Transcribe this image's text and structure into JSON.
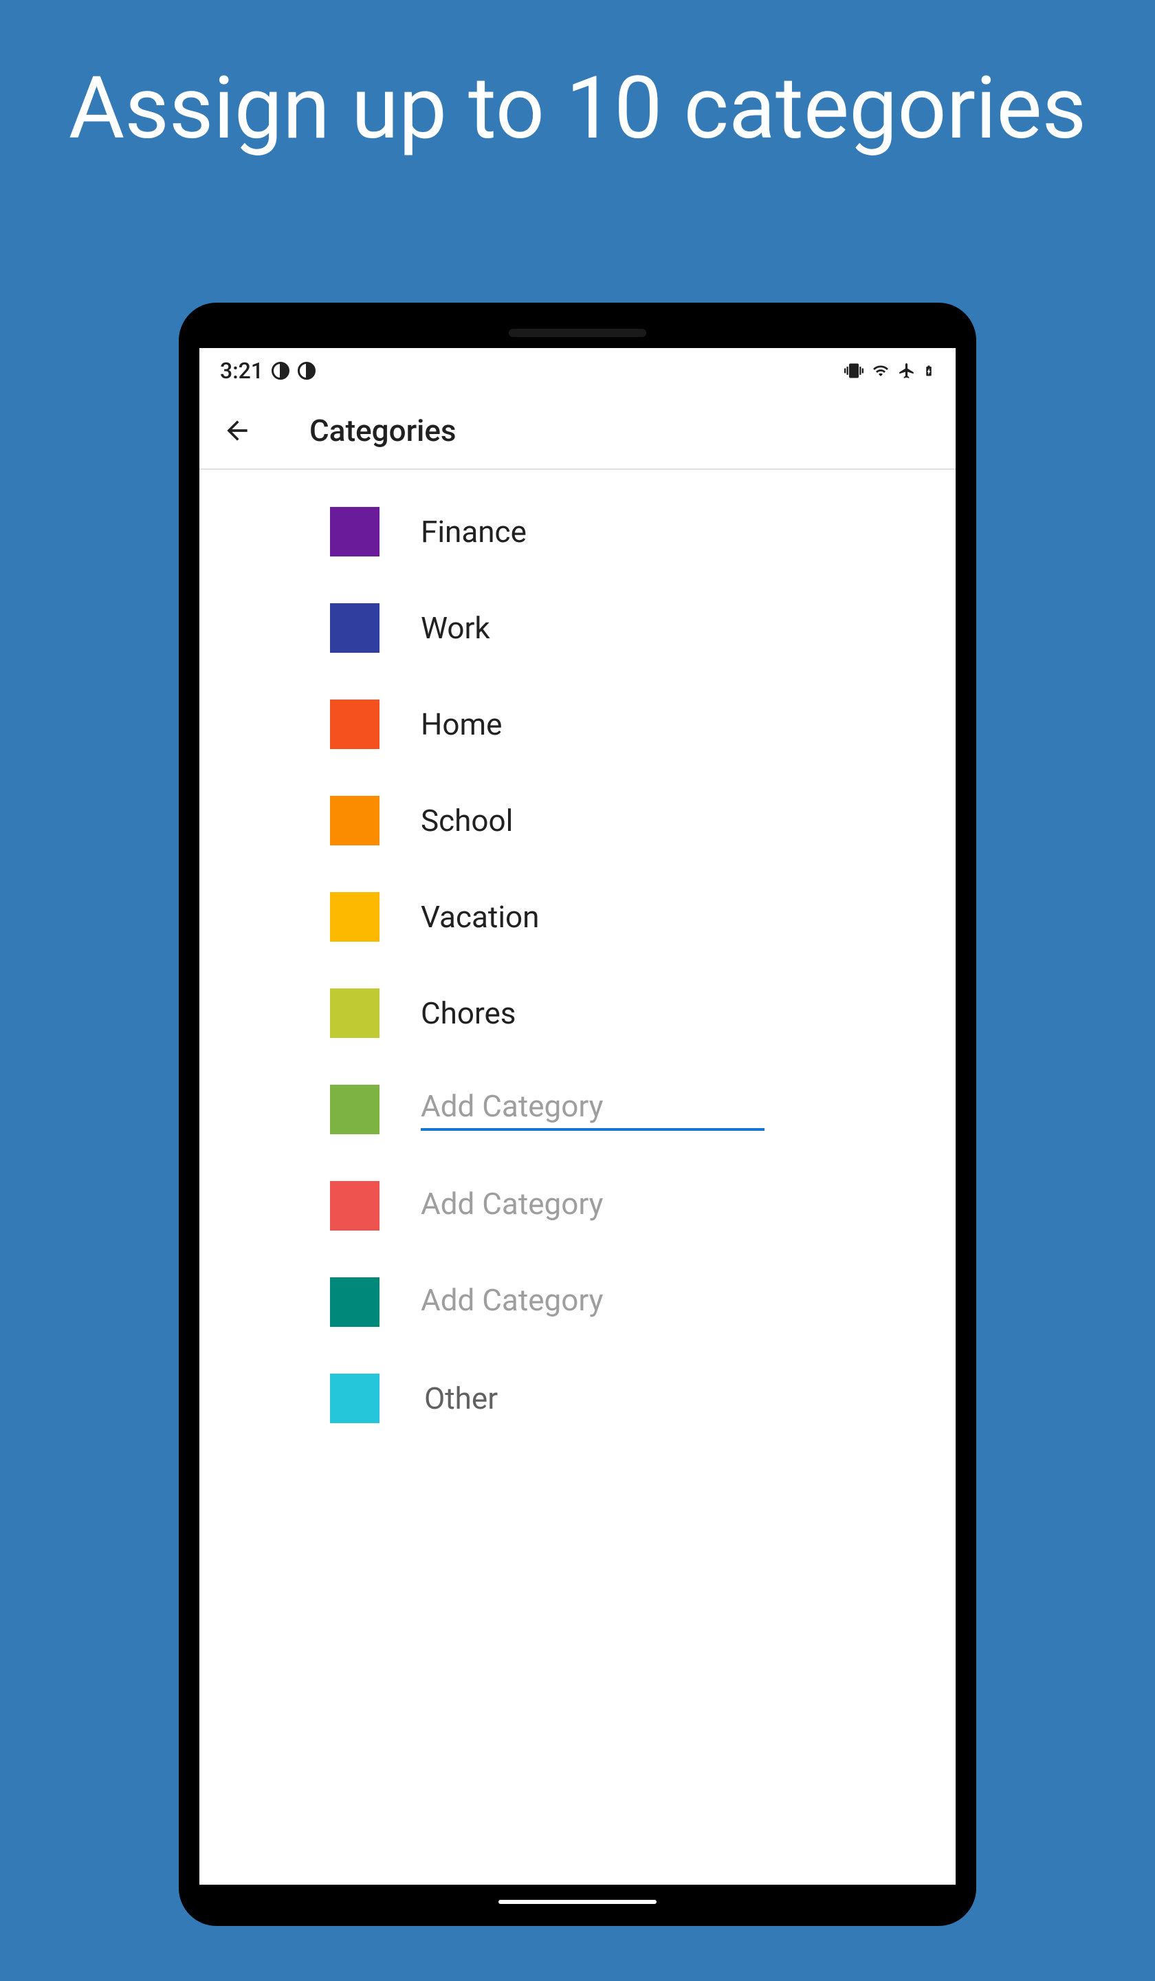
{
  "promo_title": "Assign up to 10 categories",
  "status_bar": {
    "time": "3:21"
  },
  "app_bar": {
    "title": "Categories"
  },
  "categories": [
    {
      "label": "Finance",
      "color": "#6a1b9a",
      "type": "label"
    },
    {
      "label": "Work",
      "color": "#303f9f",
      "type": "label"
    },
    {
      "label": "Home",
      "color": "#f4511e",
      "type": "label"
    },
    {
      "label": "School",
      "color": "#fb8c00",
      "type": "label"
    },
    {
      "label": "Vacation",
      "color": "#fdb900",
      "type": "label"
    },
    {
      "label": "Chores",
      "color": "#c0ca33",
      "type": "label"
    },
    {
      "label": "",
      "placeholder": "Add Category",
      "color": "#7cb342",
      "type": "input_active"
    },
    {
      "label": "",
      "placeholder": "Add Category",
      "color": "#ef5350",
      "type": "input"
    },
    {
      "label": "",
      "placeholder": "Add Category",
      "color": "#00897b",
      "type": "input"
    },
    {
      "label": "Other",
      "color": "#26c6da",
      "type": "static"
    }
  ]
}
